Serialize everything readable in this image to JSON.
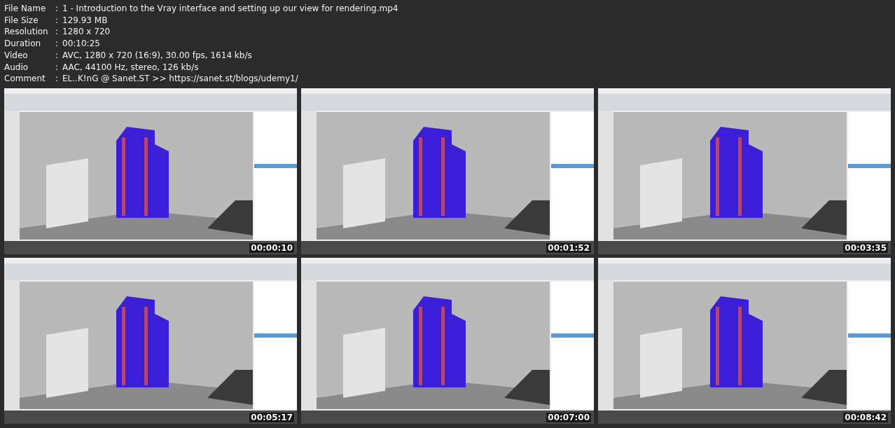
{
  "info": [
    {
      "label": "File Name",
      "value": "1 - Introduction to the Vray interface and setting up our view for rendering.mp4"
    },
    {
      "label": "File Size",
      "value": "129.93 MB"
    },
    {
      "label": "Resolution",
      "value": "1280 x 720"
    },
    {
      "label": "Duration",
      "value": "00:10:25"
    },
    {
      "label": "Video",
      "value": "AVC, 1280 x 720 (16:9), 30.00 fps, 1614 kb/s"
    },
    {
      "label": "Audio",
      "value": "AAC, 44100 Hz, stereo, 126 kb/s"
    },
    {
      "label": "Comment",
      "value": "EL..K!nG @ Sanet.ST >> https://sanet.st/blogs/udemy1/"
    }
  ],
  "separator": ":",
  "frames": [
    {
      "kind": "picture",
      "timestamp": "00:00:10"
    },
    {
      "kind": "picture",
      "timestamp": "00:01:52"
    },
    {
      "kind": "picture",
      "timestamp": "00:03:35"
    },
    {
      "kind": "picture",
      "timestamp": "00:05:17"
    },
    {
      "kind": "picture",
      "timestamp": "00:07:00"
    },
    {
      "kind": "picture",
      "timestamp": "00:08:42"
    }
  ]
}
